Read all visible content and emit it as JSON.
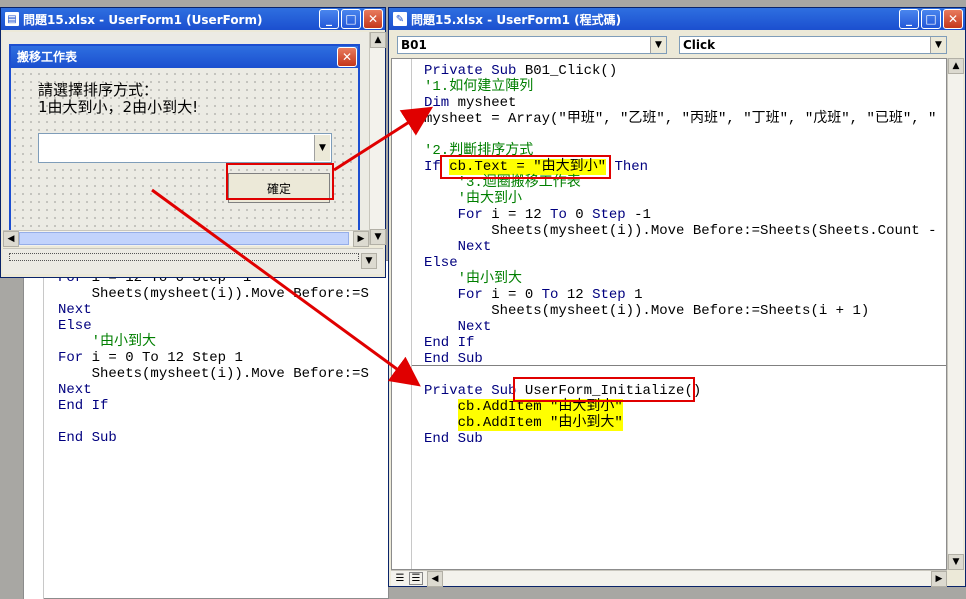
{
  "background_window": {
    "code_lines": [
      {
        "kw": "For",
        "rest": " i = 12 To 0 Step -1"
      },
      {
        "kw": "",
        "rest": "    Sheets(mysheet(i)).Move Before:=S"
      },
      {
        "kw": "Next",
        "rest": ""
      },
      {
        "kw": "Else",
        "rest": ""
      },
      {
        "kw": "",
        "rest": "    '由小到大",
        "comment": true
      },
      {
        "kw": "For",
        "rest": " i = 0 To 12 Step 1"
      },
      {
        "kw": "",
        "rest": "    Sheets(mysheet(i)).Move Before:=S"
      },
      {
        "kw": "Next",
        "rest": ""
      },
      {
        "kw": "End If",
        "rest": ""
      },
      {
        "kw": "",
        "rest": ""
      },
      {
        "kw": "End Sub",
        "rest": ""
      }
    ]
  },
  "form_window": {
    "title": "問題15.xlsx - UserForm1 (UserForm)",
    "form": {
      "title": "搬移工作表",
      "prompt_line1": "請選擇排序方式：",
      "prompt_line2": "1由大到小，2由小到大!",
      "combo_value": "",
      "ok_button": "確定"
    }
  },
  "code_window": {
    "title": "問題15.xlsx - UserForm1 (程式碼)",
    "object_combo": "B01",
    "proc_combo": "Click",
    "lines_a": [
      "Private Sub B01_Click()",
      "'1.如何建立陣列",
      "Dim mysheet",
      "mysheet = Array(\"甲班\", \"乙班\", \"丙班\", \"丁班\", \"戊班\", \"已班\", \"",
      "",
      "'2.判斷排序方式",
      "If ",
      "cb.Text = \"由大到小\"",
      " Then",
      "    '3.迴圈搬移工作表",
      "    '由大到小",
      "    For i = 12 To 0 Step -1",
      "        Sheets(mysheet(i)).Move Before:=Sheets(Sheets.Count - i)",
      "    Next",
      "Else",
      "    '由小到大",
      "    For i = 0 To 12 Step 1",
      "        Sheets(mysheet(i)).Move Before:=Sheets(i + 1)",
      "    Next",
      "End If",
      "End Sub"
    ],
    "lines_b": [
      "Private Sub ",
      "UserForm_Initialize()",
      "cb.AddItem \"由大到小\"",
      "cb.AddItem \"由小到大\"",
      "End Sub"
    ]
  },
  "colors": {
    "keyword": "#00007f",
    "comment": "#007f00",
    "highlight": "#ffff00",
    "annotation": "#e00000"
  }
}
